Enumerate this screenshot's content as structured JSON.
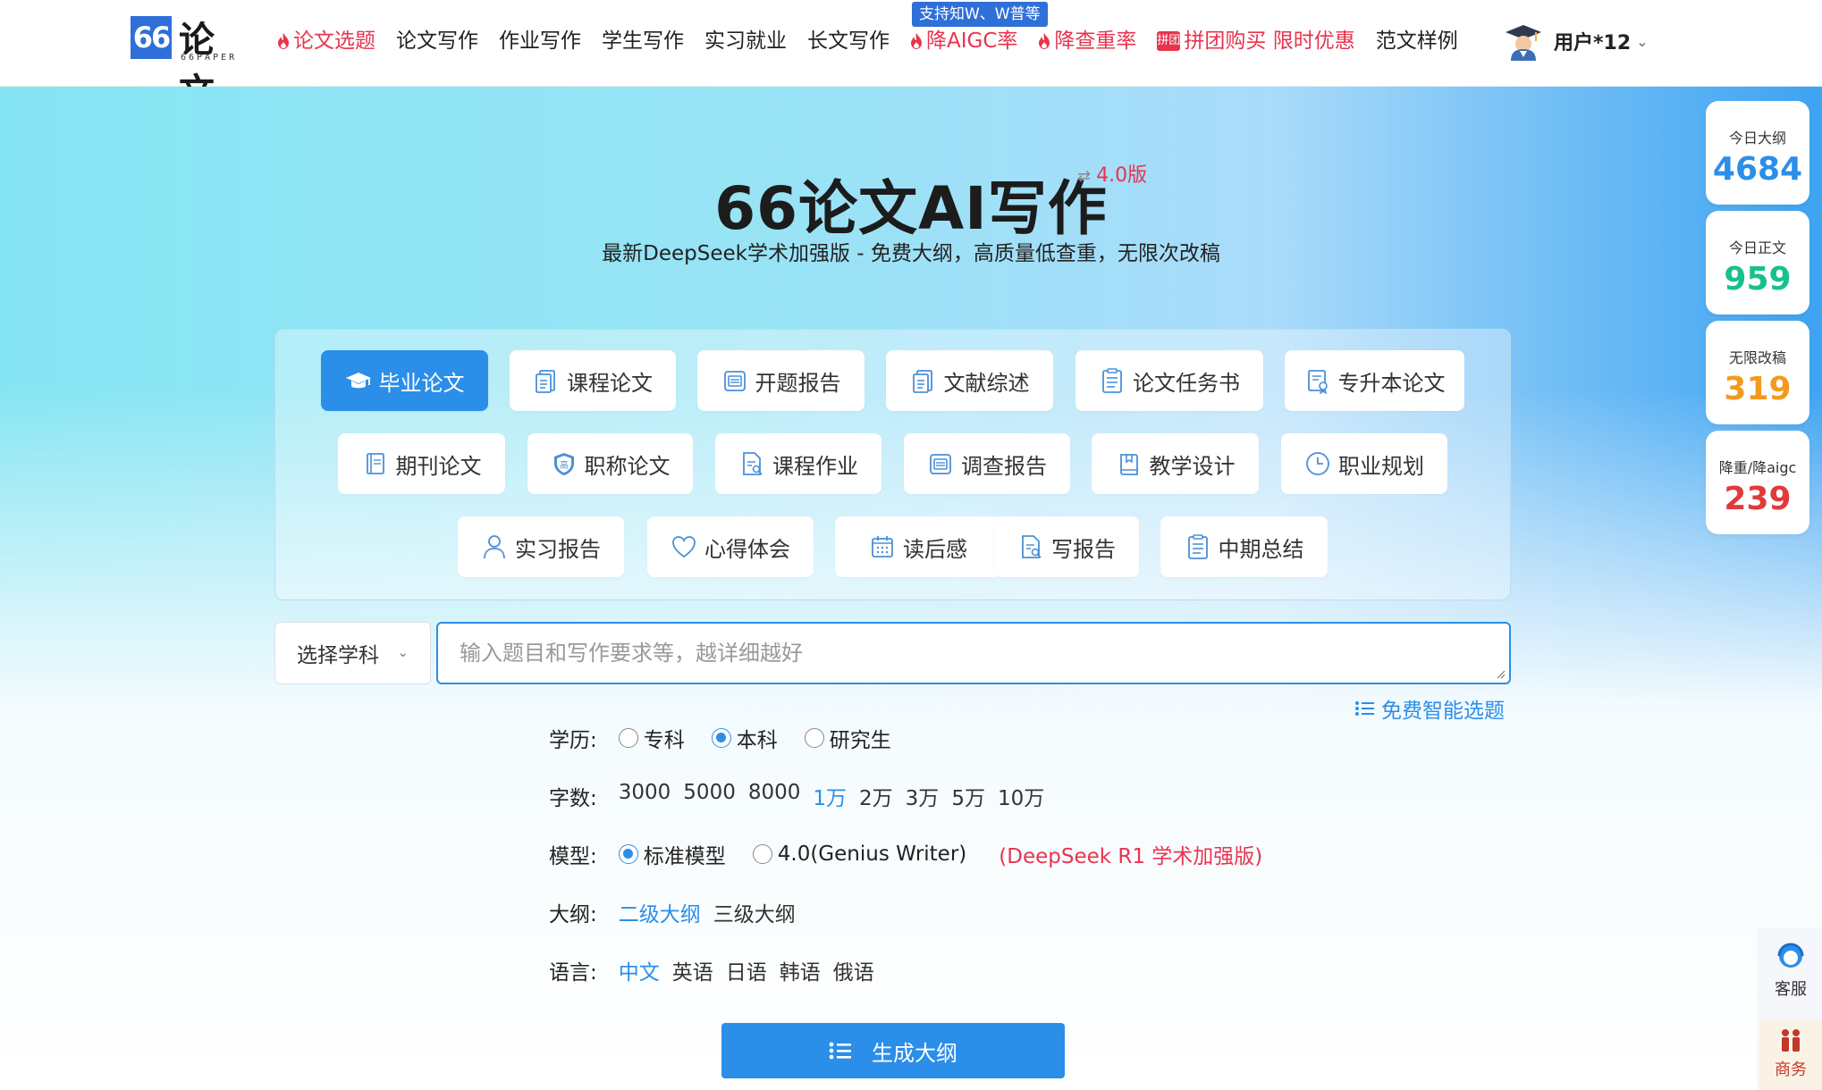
{
  "header": {
    "logo_badge": "66",
    "logo_text": "论文",
    "logo_sub": "66PAPER",
    "nav": [
      {
        "label": "论文选题",
        "hot": true
      },
      {
        "label": "论文写作",
        "hot": false
      },
      {
        "label": "作业写作",
        "hot": false
      },
      {
        "label": "学生写作",
        "hot": false
      },
      {
        "label": "实习就业",
        "hot": false
      },
      {
        "label": "长文写作",
        "hot": false
      },
      {
        "label": "降AIGC率",
        "hot": true
      },
      {
        "label": "降查重率",
        "hot": true
      },
      {
        "label": "拼团购买 限时优惠",
        "hot": true
      },
      {
        "label": "范文样例",
        "hot": false
      }
    ],
    "aigc_badge": "支持知W、W普等",
    "tuan_icon_text": "拼团",
    "user_name": "用户*12"
  },
  "hero": {
    "title": "66论文AI写作",
    "version": "4.0版",
    "subtitle": "最新DeepSeek学术加强版 - 免费大纲，高质量低查重，无限次改稿"
  },
  "categories": [
    {
      "label": "毕业论文",
      "icon": "graduation-cap-icon",
      "active": true
    },
    {
      "label": "课程论文",
      "icon": "document-icon"
    },
    {
      "label": "开题报告",
      "icon": "report-icon"
    },
    {
      "label": "文献综述",
      "icon": "document-icon"
    },
    {
      "label": "论文任务书",
      "icon": "clipboard-icon"
    },
    {
      "label": "专升本论文",
      "icon": "certificate-icon"
    },
    {
      "label": "期刊论文",
      "icon": "journal-icon"
    },
    {
      "label": "职称论文",
      "icon": "shield-icon"
    },
    {
      "label": "课程作业",
      "icon": "file-search-icon"
    },
    {
      "label": "调查报告",
      "icon": "report-icon"
    },
    {
      "label": "教学设计",
      "icon": "book-icon"
    },
    {
      "label": "职业规划",
      "icon": "clock-icon"
    },
    {
      "label": "实习报告",
      "icon": "user-icon"
    },
    {
      "label": "心得体会",
      "icon": "heart-icon"
    },
    {
      "label": "读后感",
      "icon": "calendar-icon"
    },
    {
      "label": "写报告",
      "icon": "file-search-icon"
    },
    {
      "label": "中期总结",
      "icon": "clipboard-icon"
    }
  ],
  "form": {
    "subject_label": "选择学科",
    "topic_placeholder": "输入题目和写作要求等，越详细越好",
    "smart_topic": "免费智能选题",
    "education": {
      "label": "学历:",
      "options": [
        "专科",
        "本科",
        "研究生"
      ],
      "selected": "本科"
    },
    "words": {
      "label": "字数:",
      "options": [
        "3000",
        "5000",
        "8000",
        "1万",
        "2万",
        "3万",
        "5万",
        "10万"
      ],
      "selected": "1万"
    },
    "model": {
      "label": "模型:",
      "options": [
        "标准模型",
        "4.0(Genius Writer)"
      ],
      "selected": "标准模型",
      "note": "(DeepSeek R1 学术加强版)"
    },
    "outline": {
      "label": "大纲:",
      "options": [
        "二级大纲",
        "三级大纲"
      ],
      "selected": "二级大纲"
    },
    "language": {
      "label": "语言:",
      "options": [
        "中文",
        "英语",
        "日语",
        "韩语",
        "俄语"
      ],
      "selected": "中文"
    },
    "generate_label": "生成大纲"
  },
  "stats": [
    {
      "label": "今日大纲",
      "value": "4684",
      "color": "#2b8ee9"
    },
    {
      "label": "今日正文",
      "value": "959",
      "color": "#18c18c"
    },
    {
      "label": "无限改稿",
      "value": "319",
      "color": "#f39a1e"
    },
    {
      "label": "降重/降aigc",
      "value": "239",
      "color": "#e23a3a"
    }
  ],
  "side_tools": {
    "service": "客服",
    "business": "商务"
  }
}
